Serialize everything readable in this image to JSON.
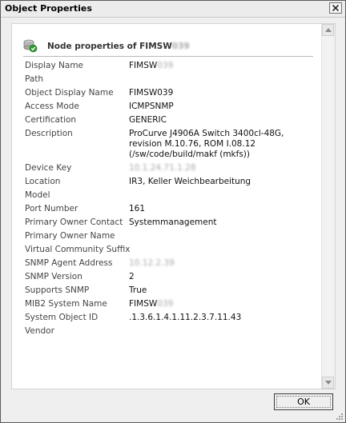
{
  "window": {
    "title": "Object Properties",
    "close_label": "X"
  },
  "header": {
    "title_prefix": "Node properties of ",
    "title_visible": "FIMSW",
    "title_obscured": "039"
  },
  "properties": [
    {
      "label": "Display Name",
      "value": "FIMSW",
      "obscured": "039"
    },
    {
      "label": "Path",
      "value": ""
    },
    {
      "label": "Object Display Name",
      "value": "FIMSW039"
    },
    {
      "label": "Access Mode",
      "value": "ICMPSNMP"
    },
    {
      "label": "Certification",
      "value": "GENERIC"
    },
    {
      "label": "Description",
      "value": "ProCurve J4906A Switch 3400cl-48G, revision M.10.76, ROM I.08.12 (/sw/code/build/makf (mkfs))"
    },
    {
      "label": "Device Key",
      "value": "",
      "obscured": "10.1.24.71.1.28"
    },
    {
      "label": "Location",
      "value": "IR3, Keller Weichbearbeitung"
    },
    {
      "label": "Model",
      "value": ""
    },
    {
      "label": "Port Number",
      "value": "161"
    },
    {
      "label": "Primary Owner Contact",
      "value": "Systemmanagement"
    },
    {
      "label": "Primary Owner Name",
      "value": ""
    },
    {
      "label": "Virtual Community Suffix",
      "value": ""
    },
    {
      "label": "SNMP Agent Address",
      "value": "",
      "obscured": "10.12.2.39"
    },
    {
      "label": "SNMP Version",
      "value": "2"
    },
    {
      "label": "Supports SNMP",
      "value": "True"
    },
    {
      "label": "MIB2 System Name",
      "value": "FIMSW",
      "obscured": "039"
    },
    {
      "label": "System Object ID",
      "value": ".1.3.6.1.4.1.11.2.3.7.11.43"
    },
    {
      "label": "Vendor",
      "value": ""
    }
  ],
  "footer": {
    "ok_label": "OK"
  }
}
